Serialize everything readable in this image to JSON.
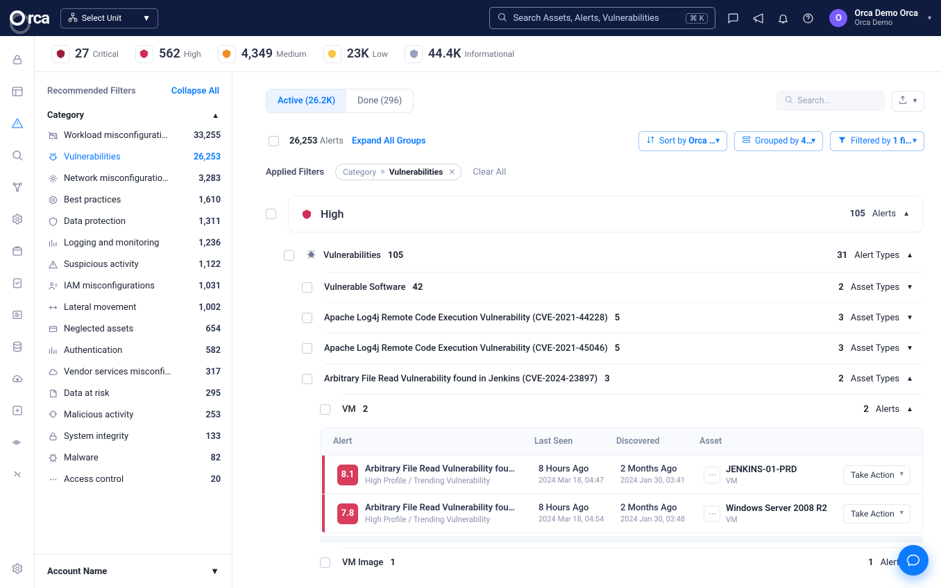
{
  "header": {
    "logo_text": "rca",
    "unit_label": "Select Unit",
    "search_placeholder": "Search Assets, Alerts, Vulnerabilities",
    "kbd": "⌘ K",
    "user": {
      "initial": "O",
      "name": "Orca Demo Orca",
      "org": "Orca Demo"
    }
  },
  "severities": [
    {
      "key": "critical",
      "count": "27",
      "label": "Critical",
      "color": "#9e1b3c"
    },
    {
      "key": "high",
      "count": "562",
      "label": "High",
      "color": "#d22d56"
    },
    {
      "key": "medium",
      "count": "4,349",
      "label": "Medium",
      "color": "#f08a24"
    },
    {
      "key": "low",
      "count": "23K",
      "label": "Low",
      "color": "#f5c84c"
    },
    {
      "key": "info",
      "count": "44.4K",
      "label": "Informational",
      "color": "#98a2ba"
    }
  ],
  "filters_panel": {
    "title": "Recommended Filters",
    "collapse": "Collapse All",
    "category_title": "Category",
    "account_title": "Account Name",
    "items": [
      {
        "name": "Workload misconfigurati…",
        "count": "33,255"
      },
      {
        "name": "Vulnerabilities",
        "count": "26,253",
        "active": true
      },
      {
        "name": "Network misconfiguratio…",
        "count": "3,283"
      },
      {
        "name": "Best practices",
        "count": "1,610"
      },
      {
        "name": "Data protection",
        "count": "1,311"
      },
      {
        "name": "Logging and monitoring",
        "count": "1,236"
      },
      {
        "name": "Suspicious activity",
        "count": "1,122"
      },
      {
        "name": "IAM misconfigurations",
        "count": "1,031"
      },
      {
        "name": "Lateral movement",
        "count": "1,002"
      },
      {
        "name": "Neglected assets",
        "count": "654"
      },
      {
        "name": "Authentication",
        "count": "582"
      },
      {
        "name": "Vendor services misconfi…",
        "count": "317"
      },
      {
        "name": "Data at risk",
        "count": "295"
      },
      {
        "name": "Malicious activity",
        "count": "253"
      },
      {
        "name": "System integrity",
        "count": "133"
      },
      {
        "name": "Malware",
        "count": "82"
      },
      {
        "name": "Access control",
        "count": "20"
      }
    ]
  },
  "tabs": {
    "active": "Active (26.2K)",
    "done": "Done (296)"
  },
  "toolbar": {
    "search_placeholder": "Search...",
    "total_count": "26,253",
    "total_label": "Alerts",
    "expand_all": "Expand All Groups",
    "sort": {
      "prefix": "Sort by ",
      "value": "Orca …"
    },
    "group": {
      "prefix": "Grouped by ",
      "value": "4…"
    },
    "filter": {
      "prefix": "Filtered by ",
      "value": "1 fi…"
    }
  },
  "applied": {
    "label": "Applied Filters",
    "chip_key": "Category",
    "chip_op": "=",
    "chip_val": "Vulnerabilities",
    "clear": "Clear All"
  },
  "group": {
    "name": "High",
    "count": "105",
    "count_label": "Alerts",
    "sub": {
      "name": "Vulnerabilities",
      "count": "105",
      "types_n": "31",
      "types_label": "Alert Types"
    },
    "rows": [
      {
        "title": "Vulnerable Software",
        "n": "42",
        "right_n": "2",
        "right_lbl": "Asset Types",
        "open": false
      },
      {
        "title": "Apache Log4j Remote Code Execution Vulnerability (CVE-2021-44228)",
        "n": "5",
        "right_n": "3",
        "right_lbl": "Asset Types",
        "open": false
      },
      {
        "title": "Apache Log4j Remote Code Execution Vulnerability (CVE-2021-45046)",
        "n": "5",
        "right_n": "3",
        "right_lbl": "Asset Types",
        "open": false
      },
      {
        "title": "Arbitrary File Read Vulnerability found in Jenkins (CVE-2024-23897)",
        "n": "3",
        "right_n": "2",
        "right_lbl": "Asset Types",
        "open": true
      }
    ],
    "vm": {
      "title": "VM",
      "n": "2",
      "right_n": "2",
      "right_lbl": "Alerts"
    },
    "vm_image": {
      "title": "VM Image",
      "n": "1",
      "right_n": "1",
      "right_lbl": "Alert"
    }
  },
  "table": {
    "cols": {
      "alert": "Alert",
      "last": "Last Seen",
      "disc": "Discovered",
      "asset": "Asset"
    },
    "action": "Take Action",
    "rows": [
      {
        "score": "8.1",
        "title": "Arbitrary File Read Vulnerability fou…",
        "sub": "High Profile / Trending Vulnerability",
        "last_big": "8 Hours Ago",
        "last_sm": "2024 Mar 18, 04:47",
        "disc_big": "2 Months Ago",
        "disc_sm": "2024 Jan 30, 03:41",
        "asset_name": "JENKINS-01-PRD",
        "asset_type": "VM"
      },
      {
        "score": "7.8",
        "title": "Arbitrary File Read Vulnerability fou…",
        "sub": "High Profile / Trending Vulnerability",
        "last_big": "8 Hours Ago",
        "last_sm": "2024 Mar 18, 04:54",
        "disc_big": "2 Months Ago",
        "disc_sm": "2024 Jan 30, 03:48",
        "asset_name": "Windows Server 2008 R2",
        "asset_type": "VM"
      }
    ]
  }
}
